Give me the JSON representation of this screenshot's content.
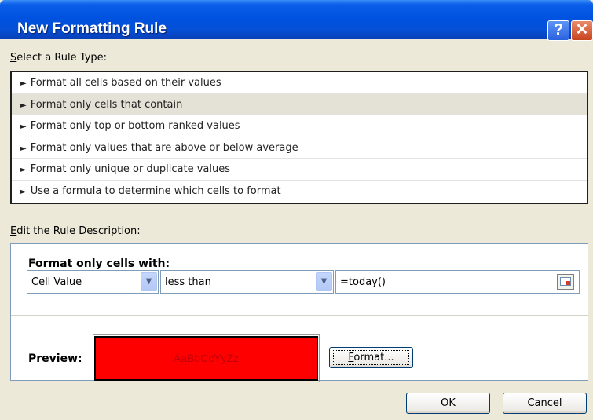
{
  "window": {
    "title": "New Formatting Rule",
    "help_glyph": "?",
    "close_glyph": "✕"
  },
  "rule_type": {
    "heading_access": "S",
    "heading_rest": "elect a Rule Type:",
    "items": [
      "Format all cells based on their values",
      "Format only cells that contain",
      "Format only top or bottom ranked values",
      "Format only values that are above or below average",
      "Format only unique or duplicate values",
      "Use a formula to determine which cells to format"
    ],
    "selected_index": 1
  },
  "description": {
    "heading_access": "E",
    "heading_rest": "dit the Rule Description:",
    "format_heading_pre": "F",
    "format_heading_access": "o",
    "format_heading_rest": "rmat only cells with:",
    "condition_type": "Cell Value",
    "operator": "less than",
    "value": "=today()",
    "preview_label": "Preview:",
    "preview_sample": "AaBbCcYyZz",
    "format_button_access": "F",
    "format_button_rest": "ormat..."
  },
  "buttons": {
    "ok": "OK",
    "cancel": "Cancel"
  },
  "colors": {
    "titlebar": "#0052e0",
    "preview_fill": "#ff0000",
    "preview_text": "#c0000a",
    "dialog_bg": "#ece9d8"
  },
  "icons": {
    "list_arrow": "►",
    "dropdown": "▼"
  }
}
